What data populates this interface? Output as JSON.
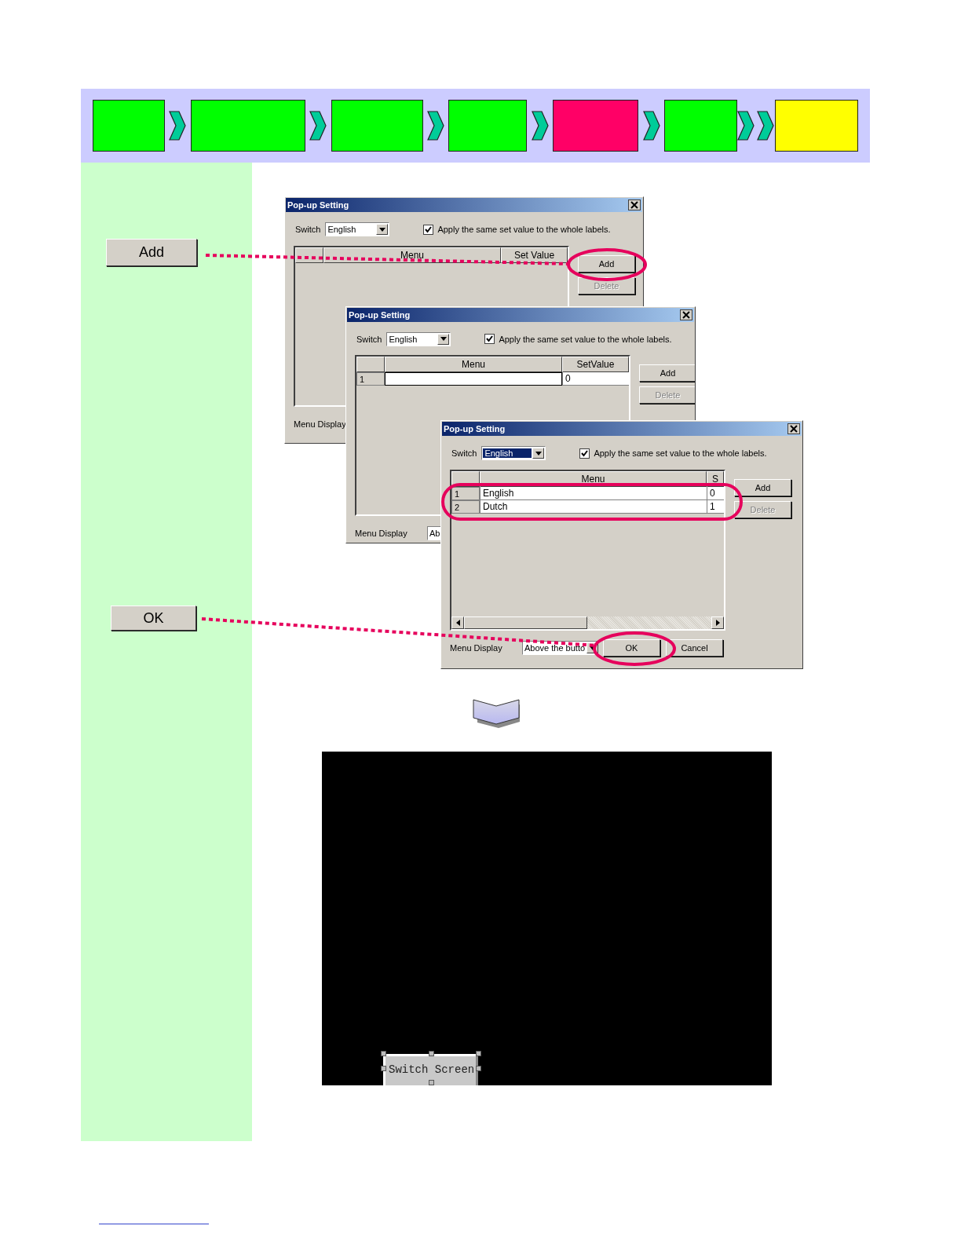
{
  "flow_steps": [
    {
      "kind": "block",
      "color": "#00ff00"
    },
    {
      "kind": "arrow"
    },
    {
      "kind": "block",
      "color": "#00ff00"
    },
    {
      "kind": "arrow"
    },
    {
      "kind": "block",
      "color": "#00ff00"
    },
    {
      "kind": "arrow"
    },
    {
      "kind": "block",
      "color": "#00ff00"
    },
    {
      "kind": "arrow"
    },
    {
      "kind": "block",
      "color": "#ff0066"
    },
    {
      "kind": "arrow"
    },
    {
      "kind": "block",
      "color": "#00ff00"
    },
    {
      "kind": "double_arrow"
    },
    {
      "kind": "block",
      "color": "#ffff00"
    }
  ],
  "sidebar": {
    "buttons": [
      {
        "label": "Add"
      },
      {
        "label": "OK"
      }
    ]
  },
  "dialogs": [
    {
      "title": "Pop-up Setting",
      "kind": "plain",
      "switch_label": "Switch",
      "switch_value": "English",
      "switch_focused": false,
      "apply_checked": true,
      "apply_label": "Apply the same set value to the whole labels.",
      "columns": [
        "Menu",
        "Set Value"
      ],
      "side_buttons": [
        {
          "label": "Add",
          "disabled": false
        },
        {
          "label": "Delete",
          "disabled": true
        }
      ],
      "menu_display_label": "Menu Display"
    },
    {
      "title": "Pop-up Setting",
      "kind": "plain",
      "switch_label": "Switch",
      "switch_value": "English",
      "switch_focused": false,
      "apply_checked": true,
      "apply_label": "Apply the same set value to the whole labels.",
      "columns": [
        "Menu",
        "SetValue"
      ],
      "rows": [
        {
          "number": "1",
          "value": "0",
          "editing": true
        }
      ],
      "side_buttons": [
        {
          "label": "Add",
          "disabled": false
        },
        {
          "label": "Delete",
          "disabled": true
        }
      ],
      "menu_display_label": "Menu Display",
      "menu_display_value": "Ab"
    },
    {
      "title": "Pop-up Setting",
      "kind": "scrolled",
      "switch_label": "Switch",
      "switch_value": "English",
      "switch_focused": true,
      "apply_checked": true,
      "apply_label": "Apply the same set value to the whole labels.",
      "columns": [
        "Menu",
        "S"
      ],
      "rows": [
        {
          "number": "1",
          "menu": "English",
          "value": "0",
          "editing": false
        },
        {
          "number": "2",
          "menu": "Dutch",
          "value": "1",
          "editing": false
        }
      ],
      "side_buttons": [
        {
          "label": "Add",
          "disabled": false
        },
        {
          "label": "Delete",
          "disabled": true
        }
      ],
      "menu_display_label": "Menu Display",
      "menu_display_value": "Above the butto",
      "footer_buttons": [
        {
          "label": "OK"
        },
        {
          "label": "Cancel"
        }
      ]
    }
  ],
  "screen_preview": {
    "button": "Switch Screen"
  }
}
